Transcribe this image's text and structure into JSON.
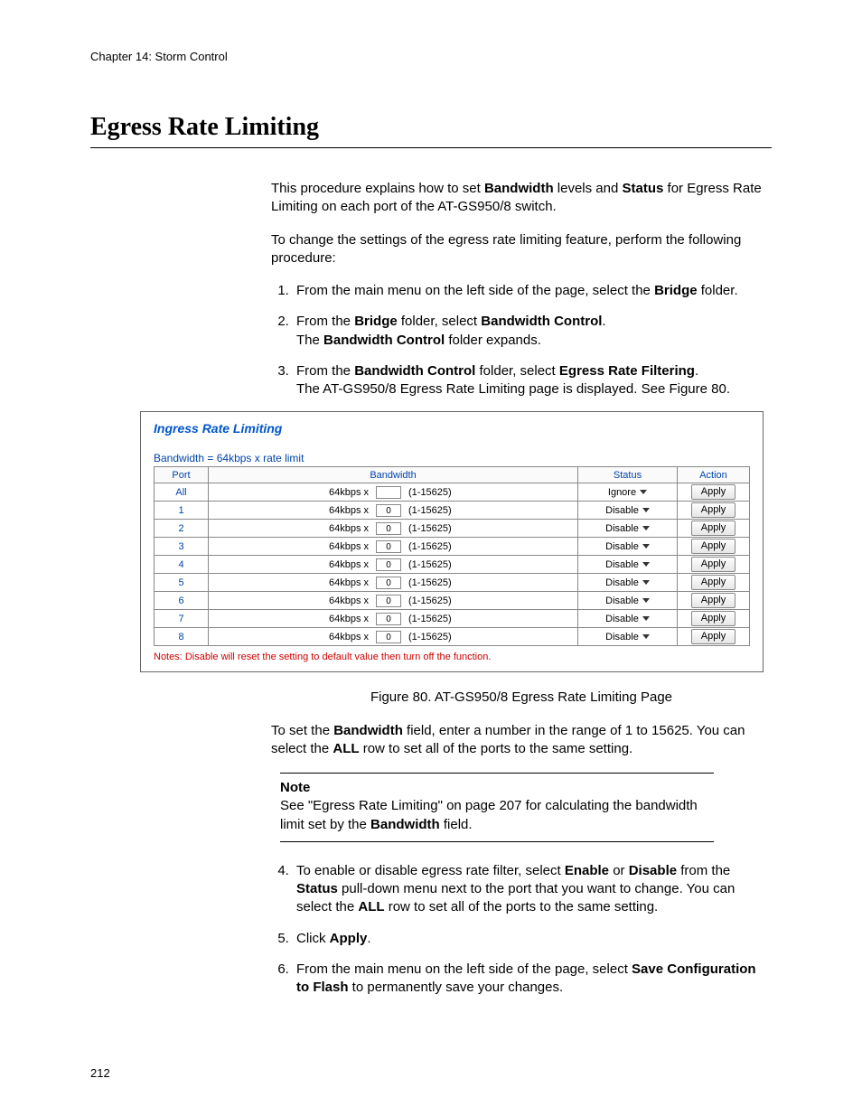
{
  "chapter_header": "Chapter 14: Storm Control",
  "page_title": "Egress Rate Limiting",
  "intro": {
    "p1_pre": "This procedure explains how to set ",
    "p1_b1": "Bandwidth",
    "p1_mid": " levels and ",
    "p1_b2": "Status",
    "p1_post": " for Egress Rate Limiting on each port of the AT-GS950/8 switch.",
    "p2": "To change the settings of the egress rate limiting feature, perform the following procedure:"
  },
  "steps_top": {
    "s1_pre": "From the main menu on the left side of the page, select the ",
    "s1_b": "Bridge",
    "s1_post": " folder.",
    "s2_l1_pre": "From the ",
    "s2_l1_b1": "Bridge",
    "s2_l1_mid": " folder, select ",
    "s2_l1_b2": "Bandwidth Control",
    "s2_l1_post": ".",
    "s2_l2_pre": "The ",
    "s2_l2_b": "Bandwidth Control",
    "s2_l2_post": " folder expands.",
    "s3_l1_pre": "From the ",
    "s3_l1_b1": "Bandwidth Control",
    "s3_l1_mid": " folder, select ",
    "s3_l1_b2": "Egress Rate Filtering",
    "s3_l1_post": ".",
    "s3_l2": "The AT-GS950/8 Egress Rate Limiting page is displayed. See Figure 80."
  },
  "figure": {
    "title": "Ingress Rate Limiting",
    "formula": "Bandwidth = 64kbps x rate limit",
    "headers": {
      "port": "Port",
      "bandwidth": "Bandwidth",
      "status": "Status",
      "action": "Action"
    },
    "bw_prefix": "64kbps x",
    "bw_range": "(1-15625)",
    "apply_label": "Apply",
    "rows": [
      {
        "port": "All",
        "value": "",
        "status": "Ignore"
      },
      {
        "port": "1",
        "value": "0",
        "status": "Disable"
      },
      {
        "port": "2",
        "value": "0",
        "status": "Disable"
      },
      {
        "port": "3",
        "value": "0",
        "status": "Disable"
      },
      {
        "port": "4",
        "value": "0",
        "status": "Disable"
      },
      {
        "port": "5",
        "value": "0",
        "status": "Disable"
      },
      {
        "port": "6",
        "value": "0",
        "status": "Disable"
      },
      {
        "port": "7",
        "value": "0",
        "status": "Disable"
      },
      {
        "port": "8",
        "value": "0",
        "status": "Disable"
      }
    ],
    "note": "Notes: Disable will reset the setting to default value then turn off the function."
  },
  "figure_caption": "Figure 80. AT-GS950/8 Egress Rate Limiting Page",
  "after_fig": {
    "p_pre": "To set the ",
    "p_b1": "Bandwidth",
    "p_mid1": " field, enter a number in the range of 1 to 15625. You can select the ",
    "p_b2": "ALL",
    "p_post": " row to set all of the ports to the same setting."
  },
  "note_box": {
    "label": "Note",
    "text_pre": "See \"Egress Rate Limiting\" on page 207 for calculating the bandwidth limit set by the ",
    "text_b": "Bandwidth",
    "text_post": " field."
  },
  "steps_bottom": {
    "s4_pre": "To enable or disable egress rate filter, select ",
    "s4_b1": "Enable",
    "s4_mid1": " or ",
    "s4_b2": "Disable",
    "s4_mid2": " from the ",
    "s4_b3": "Status",
    "s4_mid3": " pull-down menu next to the port that you want to change. You can select the ",
    "s4_b4": "ALL",
    "s4_post": " row to set all of the ports to the same setting.",
    "s5_pre": "Click ",
    "s5_b": "Apply",
    "s5_post": ".",
    "s6_pre": "From the main menu on the left side of the page, select ",
    "s6_b": "Save Configuration to Flash",
    "s6_post": " to permanently save your changes."
  },
  "page_number": "212"
}
